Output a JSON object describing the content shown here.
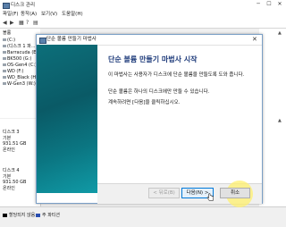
{
  "window": {
    "title": "디스크 관리",
    "minimize": "─",
    "maximize": "☐",
    "close": "✕"
  },
  "menu": [
    "파일(F)",
    "동작(A)",
    "보기(V)",
    "도움말(H)"
  ],
  "toolbar_icons": [
    "back-icon",
    "forward-icon",
    "grid-icon",
    "help-icon",
    "properties-icon",
    "icon-6",
    "icon-7",
    "icon-8",
    "icon-9"
  ],
  "volume_list": {
    "header": "볼륨",
    "items": [
      "(C:)",
      "(디스크 1 파...",
      "Barracuda (E:)",
      "BK500 (G:)",
      "OS-Gen4 (C:)",
      "WD (F:)",
      "WD_Black (H:)",
      "W-Gen3 (W:)"
    ]
  },
  "disks": [
    {
      "name": "디스크 3",
      "type": "기본",
      "size": "931.51 GB",
      "status": "온라인"
    },
    {
      "name": "디스크 4",
      "type": "기본",
      "size": "931.50 GB",
      "status": "온라인"
    }
  ],
  "status_legend": [
    {
      "label": "할당되지 않음",
      "color": "#000000"
    },
    {
      "label": "주 파티션",
      "color": "#2a4fb0"
    }
  ],
  "wizard": {
    "title": "단순 볼륨 만들기 마법사",
    "heading": "단순 볼륨 만들기 마법사 시작",
    "para1": "이 마법사는 사용자가 디스크에 단순 볼륨을 만들도록 도와 줍니다.",
    "para2": "단순 볼륨은 하나의 디스크에만 만들 수 있습니다.",
    "para3": "계속하려면 [다음]을 클릭하십시오.",
    "back_label": "< 뒤로(B)",
    "next_label": "다음(N) >",
    "cancel_label": "취소"
  }
}
